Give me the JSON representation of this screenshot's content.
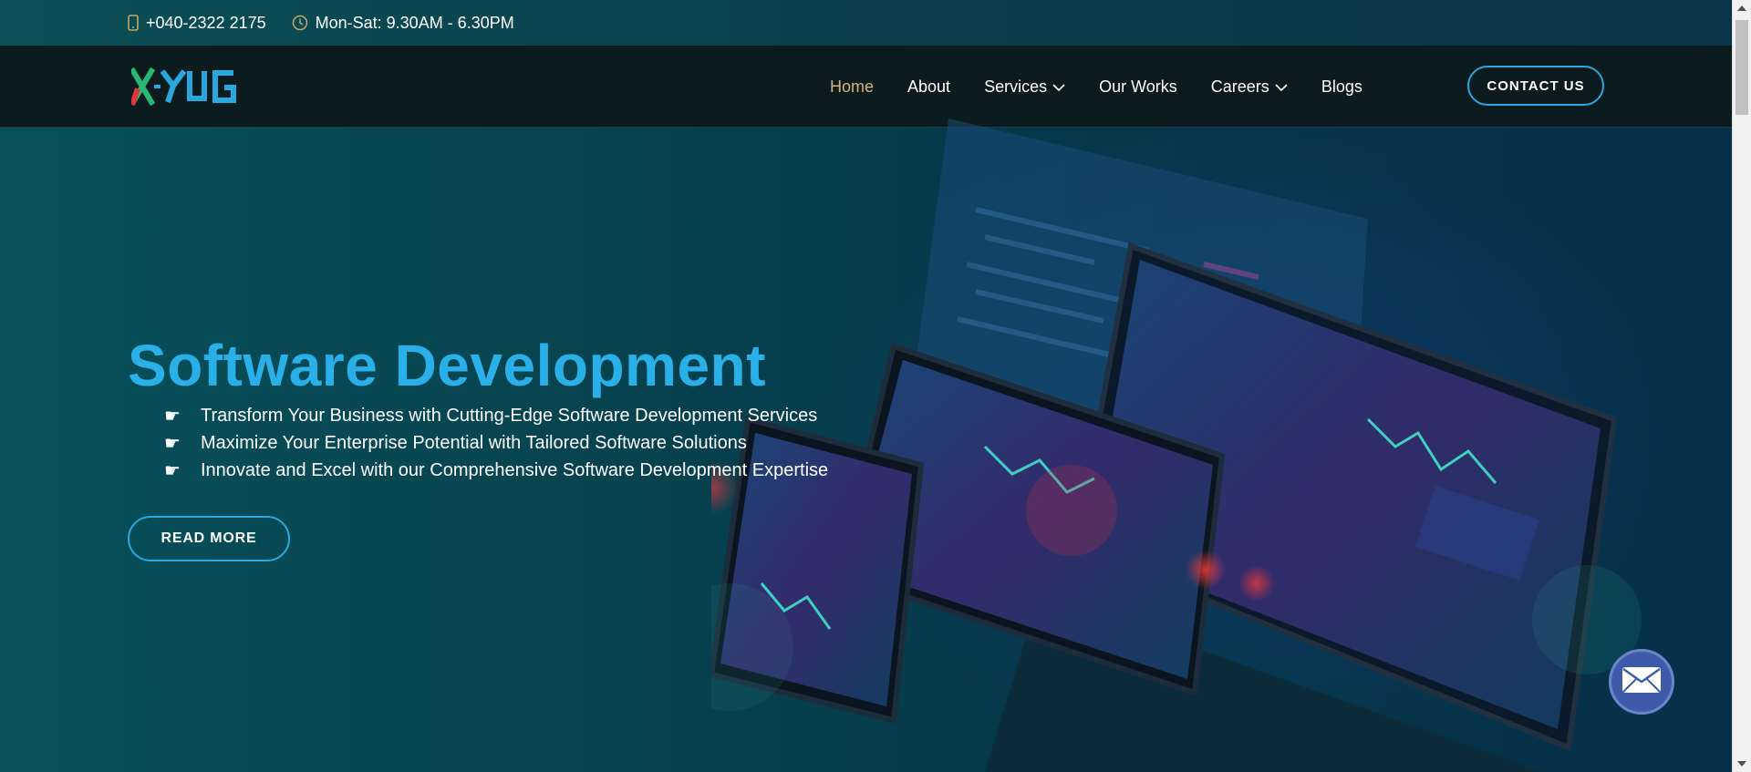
{
  "topbar": {
    "phone": "+040-2322 2175",
    "hours": "Mon-Sat: 9.30AM - 6.30PM",
    "phone_icon": "mobile-phone-icon",
    "hours_icon": "clock-icon"
  },
  "logo": {
    "text": "X-YUG"
  },
  "nav": {
    "items": [
      {
        "label": "Home",
        "active": true
      },
      {
        "label": "About"
      },
      {
        "label": "Services",
        "dropdown": true
      },
      {
        "label": "Our Works"
      },
      {
        "label": "Careers",
        "dropdown": true
      },
      {
        "label": "Blogs"
      }
    ],
    "contact_label": "CONTACT US"
  },
  "hero": {
    "title": "Software Development",
    "bullets": [
      "Transform Your Business with Cutting-Edge Software Development Services",
      "Maximize Your Enterprise Potential with Tailored Software Solutions",
      "Innovate and Excel with our Comprehensive Software Development Expertise"
    ],
    "bullet_icon": "pointing-hand-icon",
    "read_more_label": "READ MORE"
  },
  "float": {
    "icon": "envelope-icon"
  },
  "colors": {
    "accent": "#2ab0e8",
    "nav_active": "#d6b57a",
    "navbar_bg": "#0c1c1e",
    "logo_x_green": "#2bb673",
    "logo_x_red": "#e0353b",
    "logo_yug": "#29a8e0"
  }
}
